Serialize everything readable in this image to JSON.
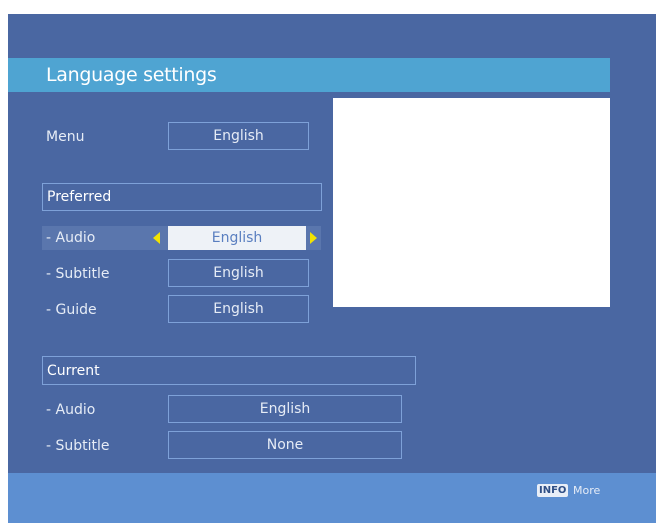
{
  "title": "Language settings",
  "menu": {
    "label": "Menu",
    "value": "English"
  },
  "preferred": {
    "header": "Preferred",
    "audio": {
      "label": "- Audio",
      "value": "English"
    },
    "subtitle": {
      "label": "- Subtitle",
      "value": "English"
    },
    "guide": {
      "label": "- Guide",
      "value": "English"
    }
  },
  "current": {
    "header": "Current",
    "audio": {
      "label": "- Audio",
      "value": "English"
    },
    "subtitle": {
      "label": "- Subtitle",
      "value": "None"
    }
  },
  "footer": {
    "info_key": "INFO",
    "info_label": "More"
  },
  "colors": {
    "background": "#4a67a2",
    "title_bar": "#4fa4d2",
    "bottom_bar": "#5d8fd1",
    "selector_arrows": "#f2e200"
  },
  "icons": [
    "arrow-left-icon",
    "arrow-right-icon"
  ]
}
